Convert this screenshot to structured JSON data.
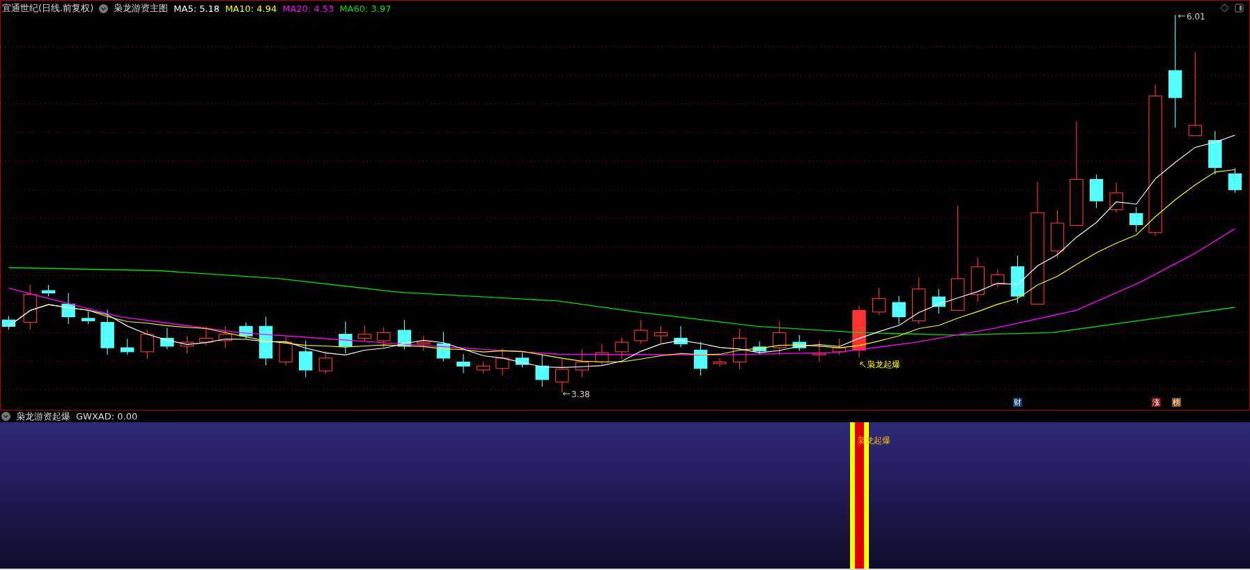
{
  "main_panel": {
    "title": "宜通世纪(日线.前复权)",
    "indicator_name": "枭龙游资主图",
    "ma": [
      {
        "label": "MA5: 5.18",
        "color": "#ffffff"
      },
      {
        "label": "MA10: 4.94",
        "color": "#ffff00"
      },
      {
        "label": "MA20: 4.53",
        "color": "#ff00ff"
      },
      {
        "label": "MA60: 3.97",
        "color": "#00e000"
      }
    ],
    "high_label": "6.01",
    "low_label": "3.38",
    "signal_label": "枭龙起爆",
    "badges": [
      {
        "text": "财",
        "color": "#0c3c78"
      },
      {
        "text": "涨",
        "color": "#8c0a0a"
      },
      {
        "text": "榜",
        "color": "#8c4a0a"
      }
    ]
  },
  "sub_panel": {
    "indicator_name": "枭龙游资起爆",
    "reading": "GWXAD: 0.00",
    "signal_label": "枭龙起爆"
  }
}
